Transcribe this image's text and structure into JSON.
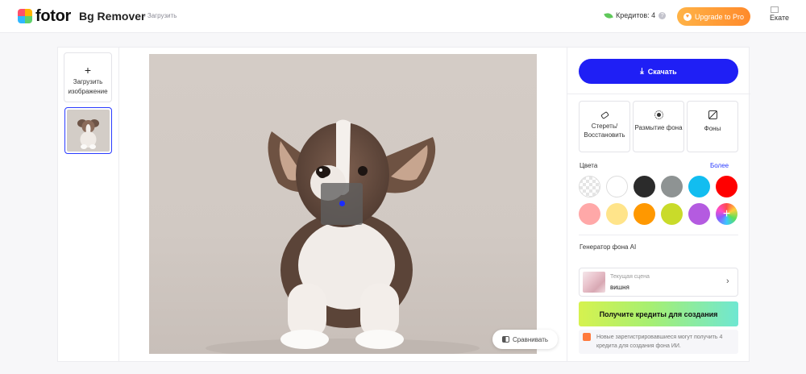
{
  "header": {
    "logo_text": "fotor",
    "app_name": "Bg Remover",
    "breadcrumb": "› Загрузить",
    "credits": "Кредитов: 4",
    "help": "?",
    "upgrade_label": "Upgrade to Pro",
    "avatar_alt": "Екате"
  },
  "left": {
    "upload_plus": "+",
    "upload_label": "Загрузить изображение"
  },
  "canvas": {
    "compare_label": "Сравнивать"
  },
  "right": {
    "download_label": "Скачать",
    "tools": [
      {
        "label": "Стереть/ Восстановить",
        "icon": "eraser-icon"
      },
      {
        "label": "Размытие фона",
        "icon": "blur-icon"
      },
      {
        "label": "Фоны",
        "icon": "background-icon"
      }
    ],
    "colors_label": "Цвета",
    "more_label": "Более",
    "colors": [
      "transparent",
      "#ffffff",
      "#2b2b2b",
      "#8e9393",
      "#12bdf0",
      "#ff0000",
      "#ffa8a8",
      "#ffe48a",
      "#ff9800",
      "#c9db2a",
      "#b45be0",
      "rainbow"
    ],
    "ai_label": "Генератор фона AI",
    "scene_caption": "Текущая сцена",
    "scene_name": "вишня",
    "cta_label": "Получите кредиты для создания",
    "promo_text": "Новые зарегистрировавшиеся могут получить 4 кредита для создания фона ИИ."
  }
}
